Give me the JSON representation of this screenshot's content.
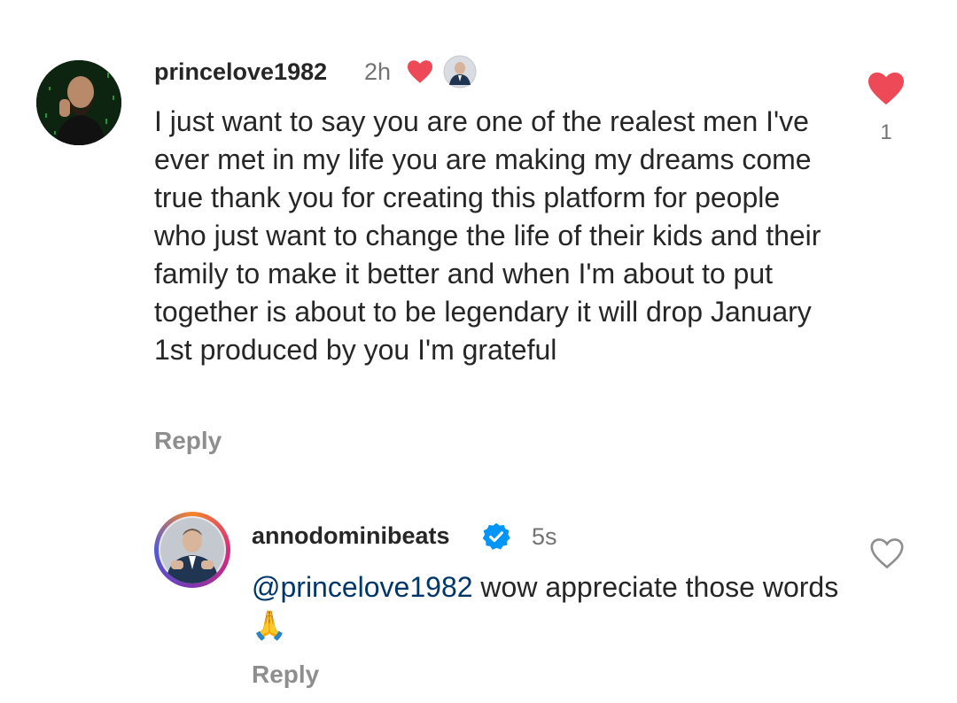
{
  "comments": [
    {
      "username": "princelove1982",
      "time": "2h",
      "text": "I just want to say you are one of the realest men I've ever met in my life you are making my dreams come true thank you for creating this platform for people who just want to change the life of their kids and their family to make it better and when I'm about to put together is about to be legendary it will drop January 1st produced by you I'm grateful",
      "reply_label": "Reply",
      "like_count": "1",
      "liked_by_creator": true,
      "liked": true,
      "colors": {
        "heart": "#ed4956"
      }
    },
    {
      "username": "annodominibeats",
      "verified": true,
      "time": "5s",
      "mention": "@princelove1982",
      "text": "wow appreciate those words",
      "emoji": "🙏",
      "reply_label": "Reply",
      "liked": false,
      "colors": {
        "verified": "#0095f6",
        "mention": "#00376b"
      }
    }
  ]
}
